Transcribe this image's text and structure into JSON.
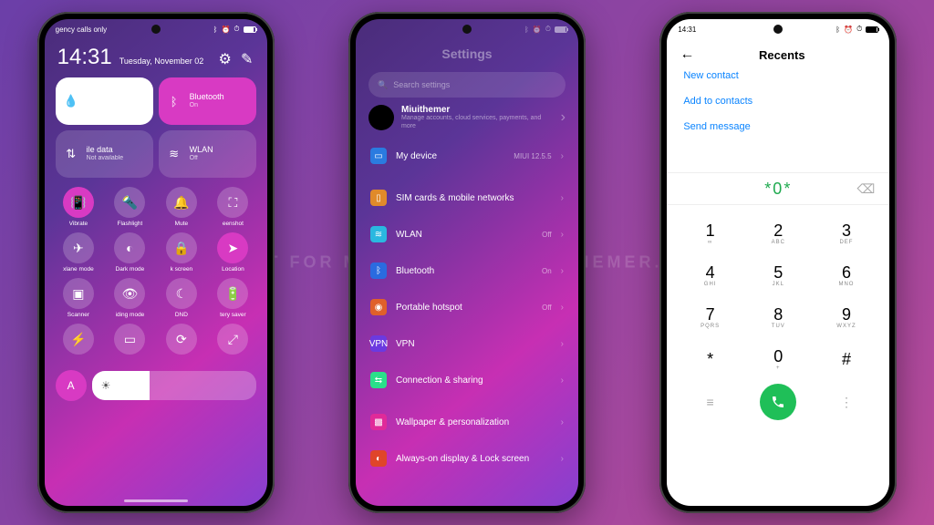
{
  "background": {
    "gradient_start": "#6b3fa8",
    "gradient_end": "#b84a9a"
  },
  "watermark": "VISIT FOR MORE THEMES   MIUITHEMER.COM",
  "status": {
    "left_text": "gency calls only",
    "time": "14:31",
    "icons": [
      "bluetooth",
      "alarm",
      "alarm",
      "battery"
    ]
  },
  "phone1": {
    "time": "14:31",
    "date": "Tuesday, November 02",
    "header_icons": [
      "settings-gear",
      "edit"
    ],
    "big_tiles": [
      {
        "style": "white",
        "icon": "droplet",
        "title": "",
        "sub": ""
      },
      {
        "style": "pink",
        "icon": "bluetooth",
        "title": "Bluetooth",
        "sub": "On"
      },
      {
        "style": "glass",
        "icon": "mobile-data",
        "title": "ile data",
        "sub": "Not available"
      },
      {
        "style": "glass",
        "icon": "wifi",
        "title": "WLAN",
        "sub": "Off"
      }
    ],
    "small_tiles": [
      {
        "icon": "vibrate",
        "label": "Vibrate",
        "active": true
      },
      {
        "icon": "flashlight",
        "label": "Flashlight",
        "active": false
      },
      {
        "icon": "bell",
        "label": "Mute",
        "active": false
      },
      {
        "icon": "screenshot",
        "label": "eenshot",
        "active": false
      },
      {
        "icon": "airplane",
        "label": "xlane mode",
        "active": false
      },
      {
        "icon": "darkmode",
        "label": "Dark mode",
        "active": false
      },
      {
        "icon": "lock",
        "label": "k screen",
        "active": false
      },
      {
        "icon": "location",
        "label": "Location",
        "active": true
      },
      {
        "icon": "scanner",
        "label": "Scanner",
        "active": false
      },
      {
        "icon": "eye",
        "label": "iding mode",
        "active": false
      },
      {
        "icon": "moon",
        "label": "DND",
        "active": false
      },
      {
        "icon": "battery-saver",
        "label": "tery saver",
        "active": false
      },
      {
        "icon": "bolt",
        "label": "",
        "active": false
      },
      {
        "icon": "cast",
        "label": "",
        "active": false
      },
      {
        "icon": "sync",
        "label": "",
        "active": false
      },
      {
        "icon": "expand",
        "label": "",
        "active": false
      }
    ],
    "fab_icon": "text-A",
    "brightness_icon": "sun"
  },
  "phone2": {
    "title": "Settings",
    "search_placeholder": "Search settings",
    "user": {
      "name": "Miuithemer",
      "sub": "Manage accounts, cloud services, payments, and more"
    },
    "rows": [
      {
        "icon": "device",
        "color": "i-blue",
        "label": "My device",
        "value": "MIUI 12.5.5"
      },
      {
        "gap": true
      },
      {
        "icon": "sim",
        "color": "i-orange",
        "label": "SIM cards & mobile networks",
        "value": ""
      },
      {
        "icon": "wifi",
        "color": "i-cyan",
        "label": "WLAN",
        "value": "Off"
      },
      {
        "icon": "bluetooth",
        "color": "i-blue2",
        "label": "Bluetooth",
        "value": "On"
      },
      {
        "icon": "hotspot",
        "color": "i-orange2",
        "label": "Portable hotspot",
        "value": "Off"
      },
      {
        "icon": "vpn",
        "color": "i-purp",
        "label": "VPN",
        "value": ""
      },
      {
        "icon": "share",
        "color": "i-green",
        "label": "Connection & sharing",
        "value": ""
      },
      {
        "gap": true
      },
      {
        "icon": "wallpaper",
        "color": "i-pink",
        "label": "Wallpaper & personalization",
        "value": ""
      },
      {
        "icon": "aod",
        "color": "i-red",
        "label": "Always-on display & Lock screen",
        "value": ""
      }
    ]
  },
  "phone3": {
    "title": "Recents",
    "actions": [
      "New contact",
      "Add to contacts",
      "Send message"
    ],
    "entry": "*0*",
    "keys": [
      {
        "n": "1",
        "l": "∞"
      },
      {
        "n": "2",
        "l": "ABC"
      },
      {
        "n": "3",
        "l": "DEF"
      },
      {
        "n": "4",
        "l": "GHI"
      },
      {
        "n": "5",
        "l": "JKL"
      },
      {
        "n": "6",
        "l": "MNO"
      },
      {
        "n": "7",
        "l": "PQRS"
      },
      {
        "n": "8",
        "l": "TUV"
      },
      {
        "n": "9",
        "l": "WXYZ"
      },
      {
        "n": "*",
        "l": ""
      },
      {
        "n": "0",
        "l": "+"
      },
      {
        "n": "#",
        "l": ""
      }
    ],
    "bottom_left_icon": "menu",
    "bottom_right_icon": "more-vertical"
  }
}
